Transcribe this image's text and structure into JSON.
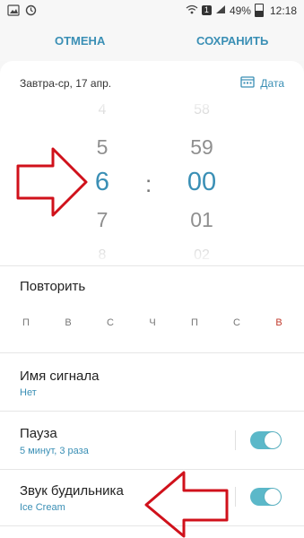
{
  "status_bar": {
    "badge": "1",
    "battery": "49%",
    "time": "12:18"
  },
  "actions": {
    "cancel": "ОТМЕНА",
    "save": "СОХРАНИТЬ"
  },
  "date": {
    "label": "Завтра-ср, 17 апр.",
    "button": "Дата"
  },
  "picker": {
    "hours": [
      "4",
      "5",
      "6",
      "7",
      "8"
    ],
    "minutes": [
      "58",
      "59",
      "00",
      "01",
      "02"
    ],
    "separator": ":"
  },
  "repeat": {
    "title": "Повторить",
    "days": [
      "П",
      "В",
      "С",
      "Ч",
      "П",
      "С",
      "В"
    ]
  },
  "alarm_name": {
    "title": "Имя сигнала",
    "value": "Нет"
  },
  "snooze": {
    "title": "Пауза",
    "value": "5 минут, 3 раза",
    "enabled": true
  },
  "sound": {
    "title": "Звук будильника",
    "value": "Ice Cream",
    "enabled": true
  },
  "colors": {
    "accent": "#3a8fb5",
    "toggle_on": "#5bb8c9",
    "arrow": "#d0111b",
    "sunday": "#c0392b"
  }
}
